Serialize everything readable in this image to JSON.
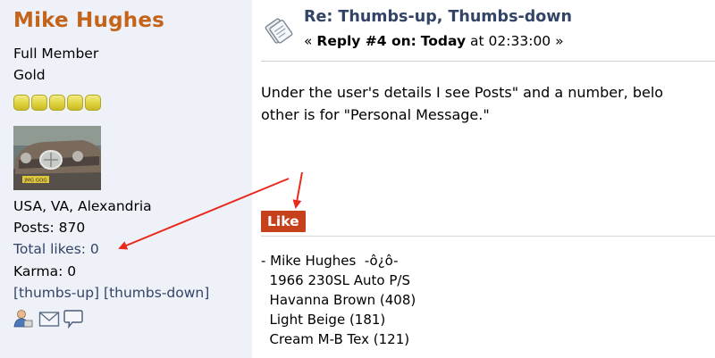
{
  "poster": {
    "name": "Mike Hughes",
    "member_group": "Full Member",
    "rank": "Gold",
    "star_count": 5,
    "location": "USA, VA, Alexandria",
    "posts_label": "Posts: 870",
    "total_likes_label": "Total likes: 0",
    "karma_label": "Karma: 0",
    "thumbs_up": "[thumbs-up]",
    "thumbs_down": "[thumbs-down]",
    "avatar_plate": "JMG GOG"
  },
  "post": {
    "subject": "Re: Thumbs-up, Thumbs-down",
    "reply_prefix": "« ",
    "reply_number": "Reply #4 on:",
    "reply_day": "Today",
    "reply_time": " at 02:33:00 »",
    "body_lines": [
      "Under the user's details I see Posts\" and a number, belo",
      "other is for \"Personal Message.\""
    ],
    "like_label": "Like",
    "signature": [
      "- Mike Hughes  -ô¿ô-",
      "  1966 230SL Auto P/S",
      "  Havanna Brown (408)",
      "  Light Beige (181)",
      "  Cream M-B Tex (121)"
    ]
  },
  "icons": {
    "profile": "profile-icon",
    "email": "email-icon",
    "pm": "message-icon",
    "subject": "post-icon"
  },
  "colors": {
    "poster_bg": "#eef1f7",
    "name": "#c4641b",
    "link": "#334466",
    "like_bg": "#c7401c",
    "arrow": "#e8291c"
  }
}
